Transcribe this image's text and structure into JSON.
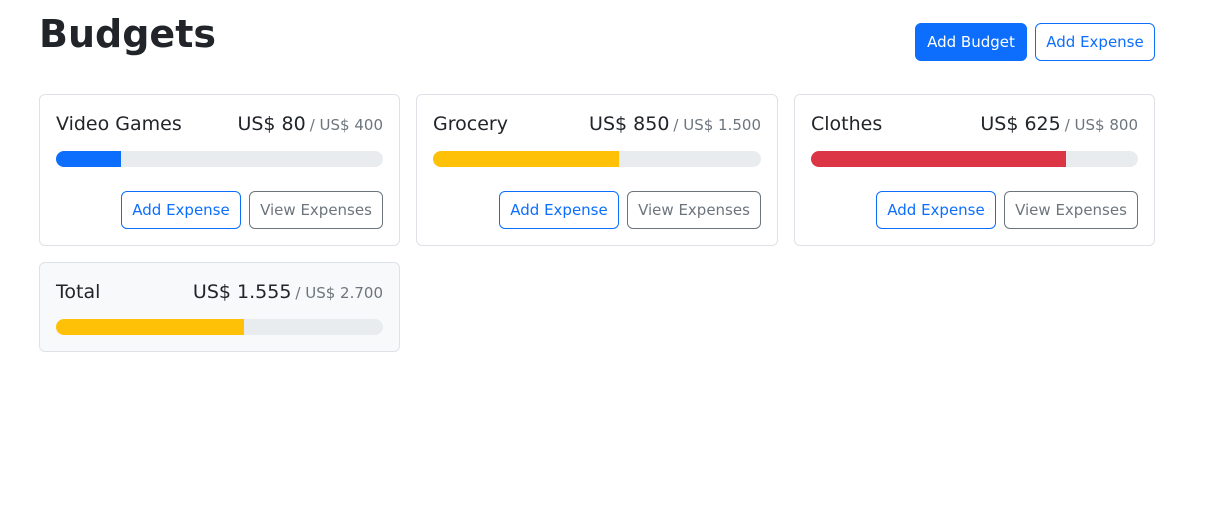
{
  "header": {
    "title": "Budgets",
    "add_budget_label": "Add Budget",
    "add_expense_label": "Add Expense"
  },
  "colors": {
    "primary": "#0d6efd",
    "warning": "#ffc107",
    "danger": "#dc3545",
    "track": "#e9ecef"
  },
  "budgets": [
    {
      "name": "Video Games",
      "amount": "US$ 80",
      "max": "/ US$ 400",
      "progress_fraction": 0.2,
      "bar_color": "#0d6efd",
      "add_expense_label": "Add Expense",
      "view_expenses_label": "View Expenses"
    },
    {
      "name": "Grocery",
      "amount": "US$ 850",
      "max": "/ US$ 1.500",
      "progress_fraction": 0.5667,
      "bar_color": "#ffc107",
      "add_expense_label": "Add Expense",
      "view_expenses_label": "View Expenses"
    },
    {
      "name": "Clothes",
      "amount": "US$ 625",
      "max": "/ US$ 800",
      "progress_fraction": 0.78125,
      "bar_color": "#dc3545",
      "add_expense_label": "Add Expense",
      "view_expenses_label": "View Expenses"
    }
  ],
  "total": {
    "name": "Total",
    "amount": "US$ 1.555",
    "max": "/ US$ 2.700",
    "progress_fraction": 0.5759,
    "bar_color": "#ffc107"
  }
}
